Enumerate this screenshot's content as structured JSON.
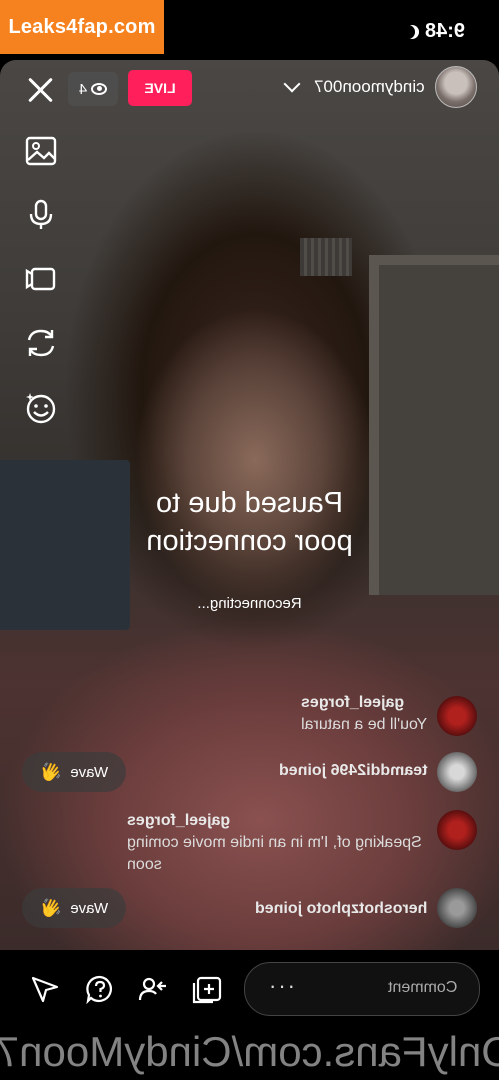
{
  "watermark": {
    "text": "Leaks4fap.com"
  },
  "status_bar": {
    "time": "9:48"
  },
  "top_bar": {
    "viewer_count": "4",
    "live_label": "LIVE",
    "host_name": "cindymoon007"
  },
  "tools": [
    "gallery-icon",
    "microphone-icon",
    "camera-icon",
    "flip-camera-icon",
    "effects-icon"
  ],
  "pause": {
    "line1": "Paused due to",
    "line2": "poor connection",
    "reconnecting": "Reconnecting..."
  },
  "comments": [
    {
      "user": "gajeel_forges",
      "message": "You'll be a natural"
    },
    {
      "user": "teamddi2496 joined",
      "wave": "Wave"
    },
    {
      "user": "gajeel_forges",
      "message": "Speaking of, I'm in an indie movie coming soon"
    },
    {
      "user": "heroshotzphoto joined",
      "wave": "Wave"
    }
  ],
  "bottom_bar": {
    "comment_placeholder": "Comment",
    "more_label": "···"
  },
  "footer_watermark": "OnlyFans.com/CindyMoon7",
  "colors": {
    "live": "#ff1f5a",
    "watermark": "#f5821f"
  }
}
